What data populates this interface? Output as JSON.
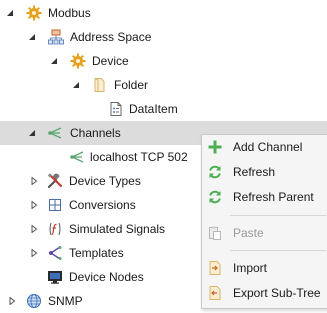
{
  "tree": {
    "modbus": "Modbus",
    "address_space": "Address Space",
    "device": "Device",
    "folder": "Folder",
    "data_item": "DataItem",
    "channels": "Channels",
    "localhost": "localhost TCP 502",
    "device_types": "Device Types",
    "conversions": "Conversions",
    "simulated_signals": "Simulated Signals",
    "templates": "Templates",
    "device_nodes": "Device Nodes",
    "snmp": "SNMP"
  },
  "context_menu": {
    "add_channel": "Add Channel",
    "refresh": "Refresh",
    "refresh_parent": "Refresh Parent",
    "paste": "Paste",
    "import": "Import",
    "export_sub_tree": "Export Sub-Tree"
  },
  "icons": {
    "modbus": "gear-icon",
    "address_space": "network-icon",
    "device": "gear-icon",
    "folder": "folder-icon",
    "data_item": "document-icon",
    "channels": "channel-icon",
    "localhost": "channel-icon",
    "device_types": "tools-icon",
    "conversions": "grid-icon",
    "simulated_signals": "function-icon",
    "templates": "templates-icon",
    "device_nodes": "monitor-icon",
    "snmp": "globe-icon",
    "add_channel": "plus-icon",
    "refresh": "refresh-icon",
    "refresh_parent": "refresh-icon",
    "paste": "paste-icon",
    "import": "import-icon",
    "export_sub_tree": "export-icon"
  },
  "colors": {
    "selection": "#dcdcdc",
    "menu_background": "#f5f5f5",
    "plus_green": "#4caf50",
    "gear_orange": "#e8a020",
    "folder_tan": "#d9b56c"
  }
}
